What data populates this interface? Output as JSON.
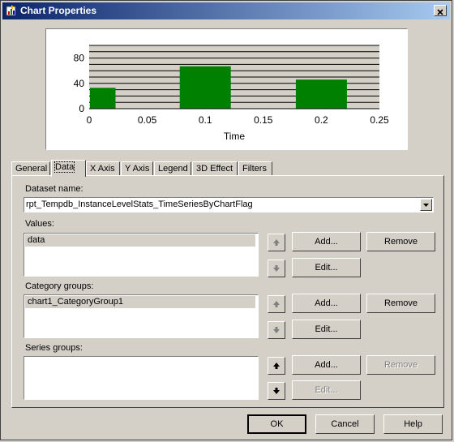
{
  "window": {
    "title": "Chart Properties"
  },
  "chart_data": {
    "type": "bar",
    "x": [
      0.011,
      0.1,
      0.2
    ],
    "values": [
      33,
      67,
      46
    ],
    "xlabel": "Time",
    "ylabel": "",
    "xlim": [
      0,
      0.25
    ],
    "ylim": [
      0,
      100
    ],
    "xticks": [
      "0",
      "0.05",
      "0.1",
      "0.15",
      "0.2",
      "0.25"
    ],
    "yticks": [
      "0",
      "40",
      "80"
    ],
    "bar_color": "#008000",
    "plot_background": "#d4d0c8",
    "grid": true
  },
  "tabs": [
    "General",
    "Data",
    "X Axis",
    "Y Axis",
    "Legend",
    "3D Effect",
    "Filters"
  ],
  "data_tab": {
    "dataset_label": "Dataset name:",
    "dataset_value": "rpt_Tempdb_InstanceLevelStats_TimeSeriesByChartFlag",
    "values_label": "Values:",
    "values_items": [
      "data"
    ],
    "category_label": "Category groups:",
    "category_items": [
      "chart1_CategoryGroup1"
    ],
    "series_label": "Series groups:",
    "add": "Add...",
    "edit": "Edit...",
    "remove": "Remove"
  },
  "footer": {
    "ok": "OK",
    "cancel": "Cancel",
    "help": "Help"
  },
  "icons": {
    "up": "up-arrow-icon",
    "down": "down-arrow-icon",
    "dropdown": "chevron-down-icon"
  }
}
